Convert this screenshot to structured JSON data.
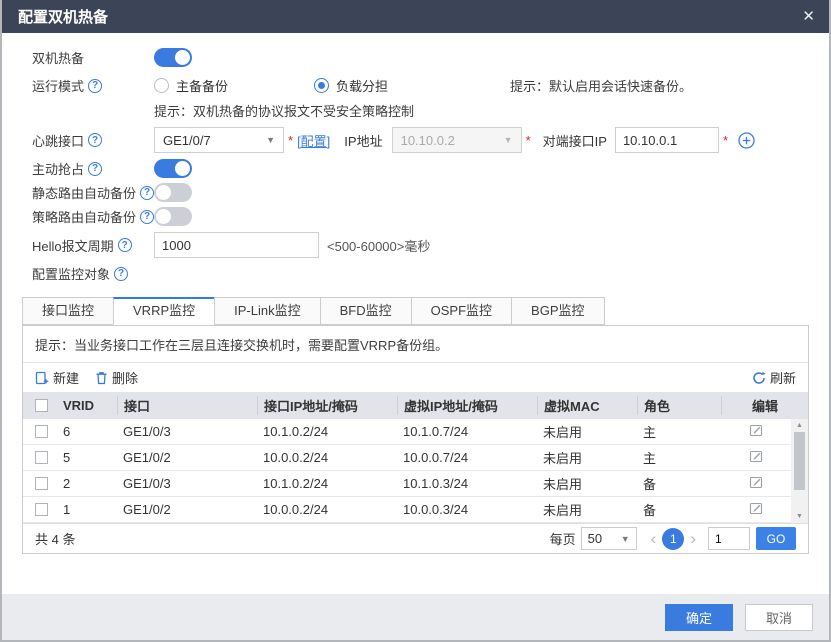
{
  "title_bar": {
    "title": "配置双机热备",
    "close_glyph": "✕"
  },
  "colors": {
    "accent": "#3a7be0",
    "titlebar": "#3c4557",
    "required": "#e02020",
    "header_bg": "#e2e4e9"
  },
  "form": {
    "hot_standby_label": "双机热备",
    "hot_standby_on": true,
    "run_mode_label": "运行模式",
    "run_mode_options": [
      {
        "label": "主备备份",
        "selected": false
      },
      {
        "label": "负载分担",
        "selected": true
      }
    ],
    "session_tip": "提示：默认启用会话快速备份。",
    "protocol_tip": "提示：双机热备的协议报文不受安全策略控制",
    "heartbeat_label": "心跳接口",
    "heartbeat_value": "GE1/0/7",
    "required_mark": "*",
    "config_link": "[配置]",
    "ip_label": "IP地址",
    "ip_value": "10.10.0.2",
    "peer_ip_label": "对端接口IP",
    "peer_ip_value": "10.10.0.1",
    "preempt_label": "主动抢占",
    "preempt_on": true,
    "static_route_label": "静态路由自动备份",
    "static_route_on": false,
    "policy_route_label": "策略路由自动备份",
    "policy_route_on": false,
    "hello_label": "Hello报文周期",
    "hello_value": "1000",
    "hello_hint": "<500-60000>毫秒",
    "monitor_label": "配置监控对象",
    "caret_glyph": "▼"
  },
  "tabs": [
    {
      "label": "接口监控"
    },
    {
      "label": "VRRP监控"
    },
    {
      "label": "IP-Link监控"
    },
    {
      "label": "BFD监控"
    },
    {
      "label": "OSPF监控"
    },
    {
      "label": "BGP监控"
    }
  ],
  "panel": {
    "tip": "提示：当业务接口工作在三层且连接交换机时，需要配置VRRP备份组。",
    "new_label": "新建",
    "delete_label": "删除",
    "refresh_label": "刷新"
  },
  "table": {
    "columns": [
      "VRID",
      "接口",
      "接口IP地址/掩码",
      "虚拟IP地址/掩码",
      "虚拟MAC",
      "角色",
      "编辑"
    ],
    "rows": [
      {
        "vrid": "6",
        "iface": "GE1/0/3",
        "ip": "10.1.0.2/24",
        "vip": "10.1.0.7/24",
        "vmac": "未启用",
        "role": "主"
      },
      {
        "vrid": "5",
        "iface": "GE1/0/2",
        "ip": "10.0.0.2/24",
        "vip": "10.0.0.7/24",
        "vmac": "未启用",
        "role": "主"
      },
      {
        "vrid": "2",
        "iface": "GE1/0/3",
        "ip": "10.1.0.2/24",
        "vip": "10.1.0.3/24",
        "vmac": "未启用",
        "role": "备"
      },
      {
        "vrid": "1",
        "iface": "GE1/0/2",
        "ip": "10.0.0.2/24",
        "vip": "10.0.0.3/24",
        "vmac": "未启用",
        "role": "备"
      }
    ],
    "scroll_up_glyph": "▲",
    "scroll_down_glyph": "▼"
  },
  "pagination": {
    "total": "共 4 条",
    "per_page_label": "每页",
    "per_page_value": "50",
    "prev_glyph": "‹",
    "current_page": "1",
    "next_glyph": "›",
    "goto_value": "1",
    "go_label": "GO"
  },
  "footer": {
    "ok_label": "确定",
    "cancel_label": "取消"
  }
}
